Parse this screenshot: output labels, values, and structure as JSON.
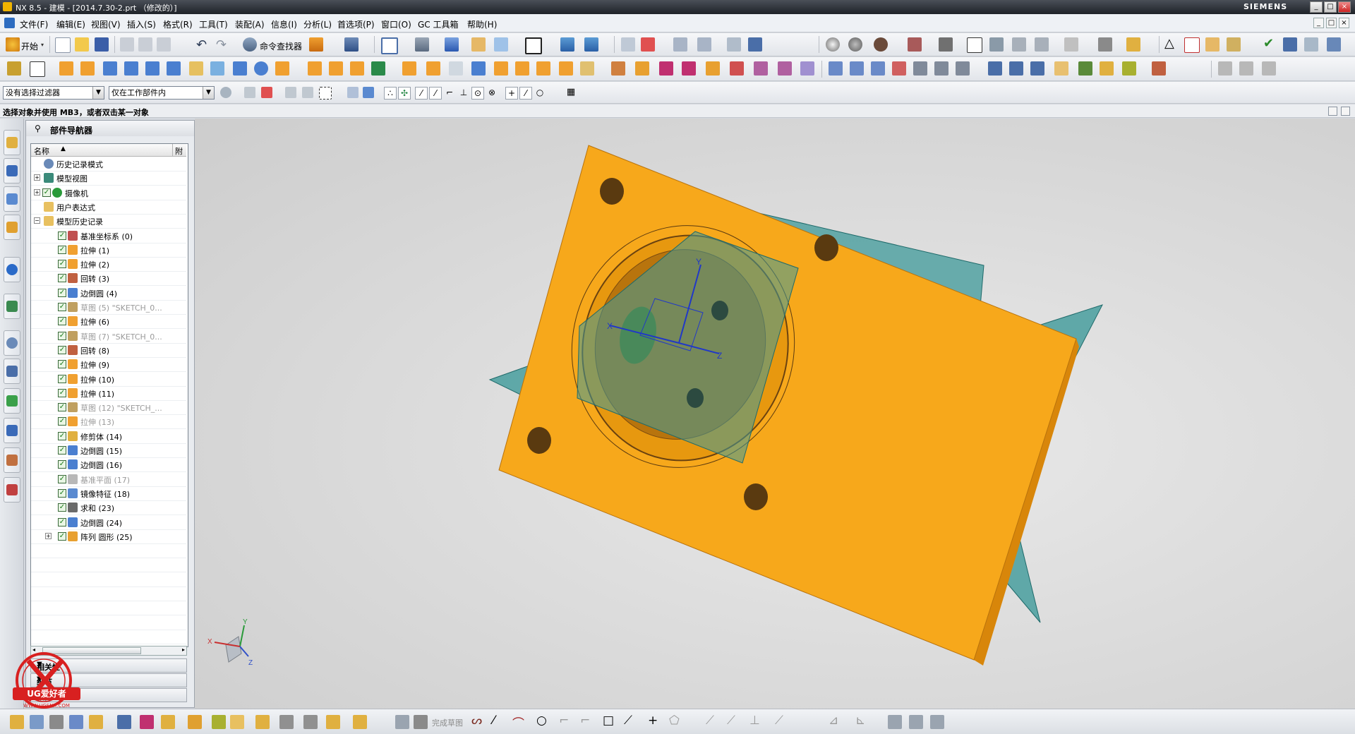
{
  "window": {
    "title": "NX 8.5 - 建模 - [2014.7.30-2.prt （修改的）]",
    "brand": "SIEMENS",
    "controls": [
      "_",
      "□",
      "×"
    ]
  },
  "menubar": {
    "items": [
      "文件(F)",
      "编辑(E)",
      "视图(V)",
      "插入(S)",
      "格式(R)",
      "工具(T)",
      "装配(A)",
      "信息(I)",
      "分析(L)",
      "首选项(P)",
      "窗口(O)",
      "GC 工具箱",
      "帮助(H)"
    ]
  },
  "toolbar": {
    "start_label": "开始",
    "command_finder_label": "命令查找器"
  },
  "selection_bar": {
    "type_filter": "没有选择过滤器",
    "scope": "仅在工作部件内"
  },
  "cue_line": "选择对象并使用 MB3，或者双击某一对象",
  "part_navigator": {
    "title": "部件导航器",
    "columns": [
      "名称",
      "附"
    ],
    "rows": [
      {
        "label": "历史记录模式",
        "indent": 1,
        "expander": "",
        "check": false,
        "icon": "clock-icon",
        "dim": false
      },
      {
        "label": "模型视图",
        "indent": 1,
        "expander": "+",
        "check": false,
        "icon": "model-views-icon",
        "dim": false
      },
      {
        "label": "摄像机",
        "indent": 1,
        "expander": "+",
        "check": true,
        "icon": "camera-icon",
        "dim": false
      },
      {
        "label": "用户表达式",
        "indent": 1,
        "expander": "",
        "check": false,
        "icon": "folder-icon",
        "dim": false
      },
      {
        "label": "模型历史记录",
        "indent": 1,
        "expander": "−",
        "check": false,
        "icon": "folder-open-icon",
        "dim": false
      },
      {
        "label": "基准坐标系 (0)",
        "indent": 2,
        "expander": "",
        "check": true,
        "icon": "datum-csys-icon",
        "dim": false
      },
      {
        "label": "拉伸 (1)",
        "indent": 2,
        "expander": "",
        "check": true,
        "icon": "extrude-icon",
        "dim": false
      },
      {
        "label": "拉伸 (2)",
        "indent": 2,
        "expander": "",
        "check": true,
        "icon": "extrude-icon",
        "dim": false
      },
      {
        "label": "回转 (3)",
        "indent": 2,
        "expander": "",
        "check": true,
        "icon": "revolve-icon",
        "dim": false
      },
      {
        "label": "边倒圆 (4)",
        "indent": 2,
        "expander": "",
        "check": true,
        "icon": "edge-blend-icon",
        "dim": false
      },
      {
        "label": "草图 (5) \"SKETCH_0...",
        "indent": 2,
        "expander": "",
        "check": true,
        "icon": "sketch-icon",
        "dim": true
      },
      {
        "label": "拉伸 (6)",
        "indent": 2,
        "expander": "",
        "check": true,
        "icon": "extrude-icon",
        "dim": false
      },
      {
        "label": "草图 (7) \"SKETCH_0...",
        "indent": 2,
        "expander": "",
        "check": true,
        "icon": "sketch-icon",
        "dim": true
      },
      {
        "label": "回转 (8)",
        "indent": 2,
        "expander": "",
        "check": true,
        "icon": "revolve-icon",
        "dim": false
      },
      {
        "label": "拉伸 (9)",
        "indent": 2,
        "expander": "",
        "check": true,
        "icon": "extrude-icon",
        "dim": false
      },
      {
        "label": "拉伸 (10)",
        "indent": 2,
        "expander": "",
        "check": true,
        "icon": "extrude-icon",
        "dim": false
      },
      {
        "label": "拉伸 (11)",
        "indent": 2,
        "expander": "",
        "check": true,
        "icon": "extrude-icon",
        "dim": false
      },
      {
        "label": "草图 (12) \"SKETCH_...",
        "indent": 2,
        "expander": "",
        "check": true,
        "icon": "sketch-icon",
        "dim": true
      },
      {
        "label": "拉伸 (13)",
        "indent": 2,
        "expander": "",
        "check": true,
        "icon": "extrude-icon",
        "dim": true
      },
      {
        "label": "修剪体 (14)",
        "indent": 2,
        "expander": "",
        "check": true,
        "icon": "trim-body-icon",
        "dim": false
      },
      {
        "label": "边倒圆 (15)",
        "indent": 2,
        "expander": "",
        "check": true,
        "icon": "edge-blend-icon",
        "dim": false
      },
      {
        "label": "边倒圆 (16)",
        "indent": 2,
        "expander": "",
        "check": true,
        "icon": "edge-blend-icon",
        "dim": false
      },
      {
        "label": "基准平面 (17)",
        "indent": 2,
        "expander": "",
        "check": true,
        "icon": "datum-plane-icon",
        "dim": true
      },
      {
        "label": "镜像特征 (18)",
        "indent": 2,
        "expander": "",
        "check": true,
        "icon": "mirror-feature-icon",
        "dim": false
      },
      {
        "label": "求和 (23)",
        "indent": 2,
        "expander": "",
        "check": true,
        "icon": "unite-icon",
        "dim": false
      },
      {
        "label": "边倒圆 (24)",
        "indent": 2,
        "expander": "",
        "check": true,
        "icon": "edge-blend-icon",
        "dim": false
      },
      {
        "label": "阵列 圆形 (25)",
        "indent": 2,
        "expander": "+",
        "check": true,
        "icon": "pattern-icon",
        "dim": false
      }
    ],
    "panels": [
      "相关性",
      "细节",
      "预览"
    ]
  },
  "sketch_toolbar": {
    "finish_sketch_label": "完成草图"
  },
  "graphics": {
    "triad_labels": {
      "x": "X",
      "y": "Y",
      "z": "Z"
    },
    "small_triad_labels": {
      "x": "X",
      "y": "Y",
      "z": "Z"
    },
    "colors": {
      "body": "#f7a81b",
      "body_side": "#d8860a",
      "plane": "#3f9a9a",
      "background": "#d8d8d8"
    }
  },
  "watermark": {
    "text": "UG爱好者",
    "url": "WWW.UGSNX.COM"
  }
}
